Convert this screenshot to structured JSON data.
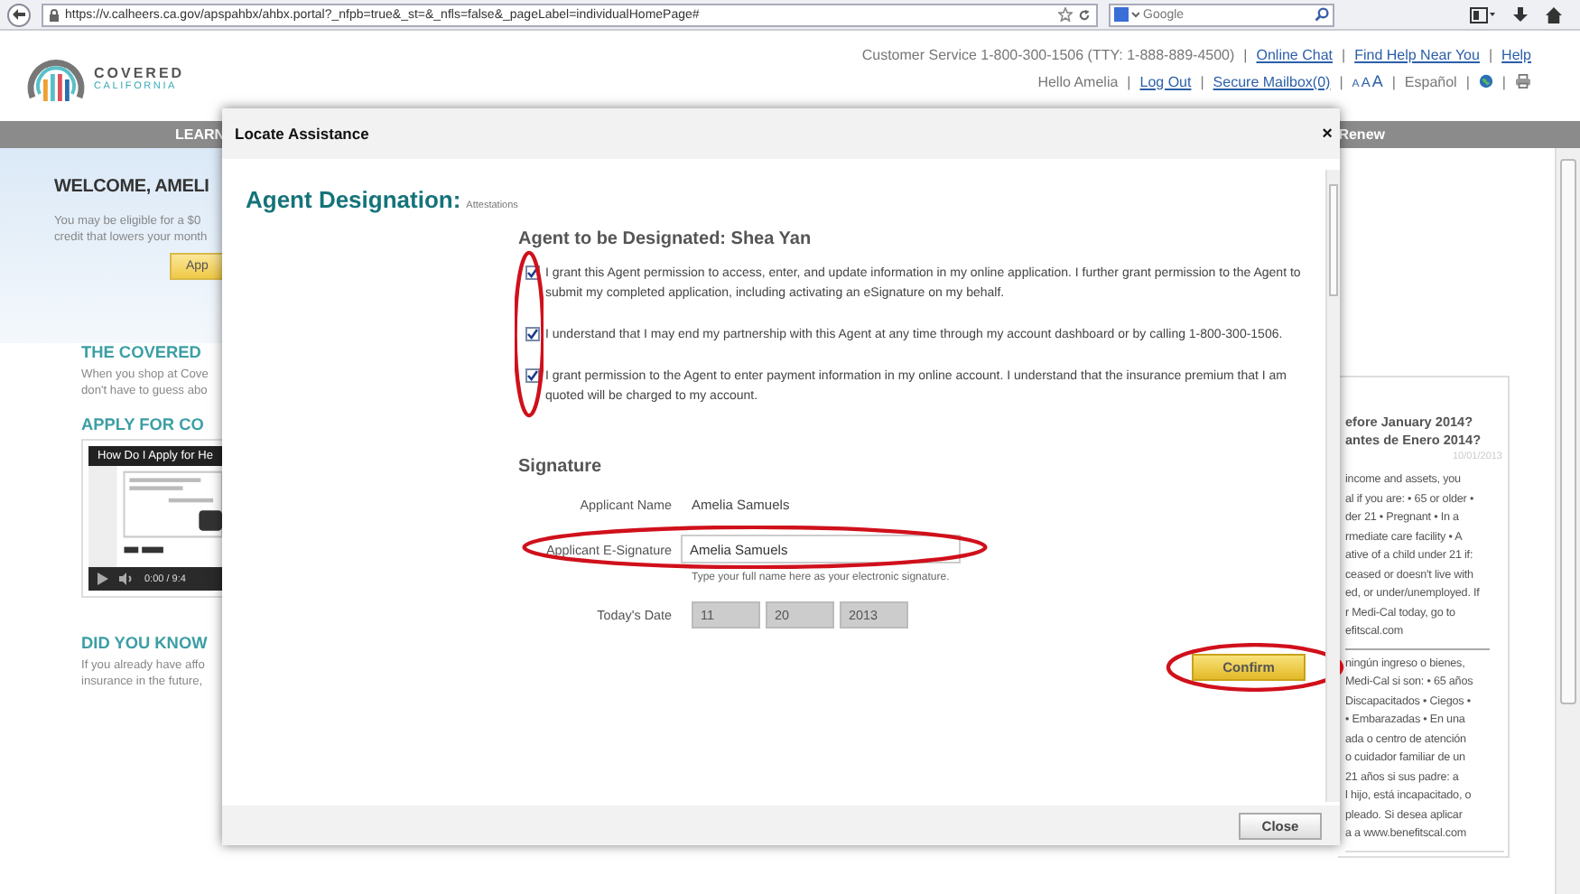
{
  "browser": {
    "url": "https://v.calheers.ca.gov/apspahbx/ahbx.portal?_nfpb=true&_st=&_nfls=false&_pageLabel=individualHomePage#",
    "search_placeholder": "Google"
  },
  "header": {
    "logo": {
      "line1": "COVERED",
      "line2": "CALIFORNIA"
    },
    "top_links": [
      {
        "kind": "text",
        "text": "Customer Service 1-800-300-1506 (TTY: 1-888-889-4500)"
      },
      {
        "kind": "sep",
        "text": "|"
      },
      {
        "kind": "link",
        "text": "Online Chat"
      },
      {
        "kind": "sep",
        "text": "|"
      },
      {
        "kind": "link",
        "text": "Find Help Near You"
      },
      {
        "kind": "sep",
        "text": "|"
      },
      {
        "kind": "link",
        "text": "Help"
      }
    ],
    "user_links": [
      {
        "kind": "text",
        "text": "Hello Amelia"
      },
      {
        "kind": "sep",
        "text": "|"
      },
      {
        "kind": "link",
        "text": "Log Out"
      },
      {
        "kind": "sep",
        "text": "|"
      },
      {
        "kind": "link",
        "text": "Secure Mailbox(0)"
      },
      {
        "kind": "sep",
        "text": "|"
      },
      {
        "kind": "sizes",
        "letters": [
          "A",
          "A",
          "A"
        ]
      },
      {
        "kind": "sep",
        "text": "|"
      },
      {
        "kind": "text",
        "text": "Español"
      },
      {
        "kind": "sep",
        "text": "|"
      },
      {
        "kind": "globe"
      },
      {
        "kind": "sep",
        "text": "|"
      },
      {
        "kind": "print"
      }
    ]
  },
  "nav": [
    "LEARN",
    "Renew"
  ],
  "welcome": {
    "title": "WELCOME, AMELI",
    "lines": [
      "You may be eligible for a $0",
      "credit that lowers your month"
    ],
    "button": "App"
  },
  "sections": [
    {
      "kind": "text",
      "title": "THE COVERED",
      "lines": [
        "When you shop at Cove",
        "don't have to guess abo"
      ]
    },
    {
      "kind": "video",
      "title": "APPLY FOR CO",
      "video_title": "How Do I Apply for He",
      "time": "0:00 / 9:4"
    },
    {
      "kind": "text",
      "title": "DID YOU KNOW",
      "lines": [
        "If you already have affo",
        "insurance in the future,"
      ]
    }
  ],
  "news": {
    "titles": [
      "efore January 2014?",
      "antes de Enero 2014?"
    ],
    "date": "10/01/2013",
    "paragraphs": [
      [
        "income and assets, you",
        "al if you are: • 65 or older •",
        "der 21 • Pregnant • In a",
        "rmediate care facility • A",
        "ative of a child under 21 if:",
        "ceased or doesn't live with",
        "ed, or under/unemployed. If",
        "r Medi-Cal today, go to",
        "efitscal.com"
      ],
      [
        "ningún ingreso o bienes,",
        "Medi-Cal si son: • 65 años",
        "Discapacitados • Ciegos •",
        "• Embarazadas • En una",
        "ada o centro de atención",
        "o cuidador familiar de un",
        "21 años si sus padre: a",
        "l hijo, está incapacitado, o",
        "pleado. Si desea aplicar",
        "a a www.benefitscal.com"
      ]
    ]
  },
  "modal": {
    "title": "Locate Assistance",
    "close_symbol": "×",
    "heading": "Agent Designation:",
    "subheading": "Attestations",
    "agent_title": "Agent to be Designated: Shea Yan",
    "attestations_highlighted": true,
    "attestations": [
      {
        "text": "I grant this Agent permission to access, enter, and update information in my online application. I further grant permission to the Agent to submit my completed application, including activating an eSignature on my behalf.",
        "checked": true
      },
      {
        "text": "I understand that I may end my partnership with this Agent at any time through my account dashboard or by calling 1-800-300-1506.",
        "checked": true
      },
      {
        "text": "I grant permission to the Agent to enter payment information in my online account. I understand that the insurance premium that I am quoted will be charged to my account.",
        "checked": true
      }
    ],
    "signature": {
      "title": "Signature",
      "name_label": "Applicant Name",
      "name_value": "Amelia Samuels",
      "esig_label": "Applicant E-Signature",
      "esig_value": "Amelia Samuels",
      "esig_hint": "Type your full name here as your electronic signature.",
      "esig_highlighted": true,
      "date_label": "Today's Date",
      "date": [
        "11",
        "20",
        "2013"
      ]
    },
    "confirm": {
      "label": "Confirm",
      "highlighted": true
    },
    "footer_button": "Close"
  }
}
